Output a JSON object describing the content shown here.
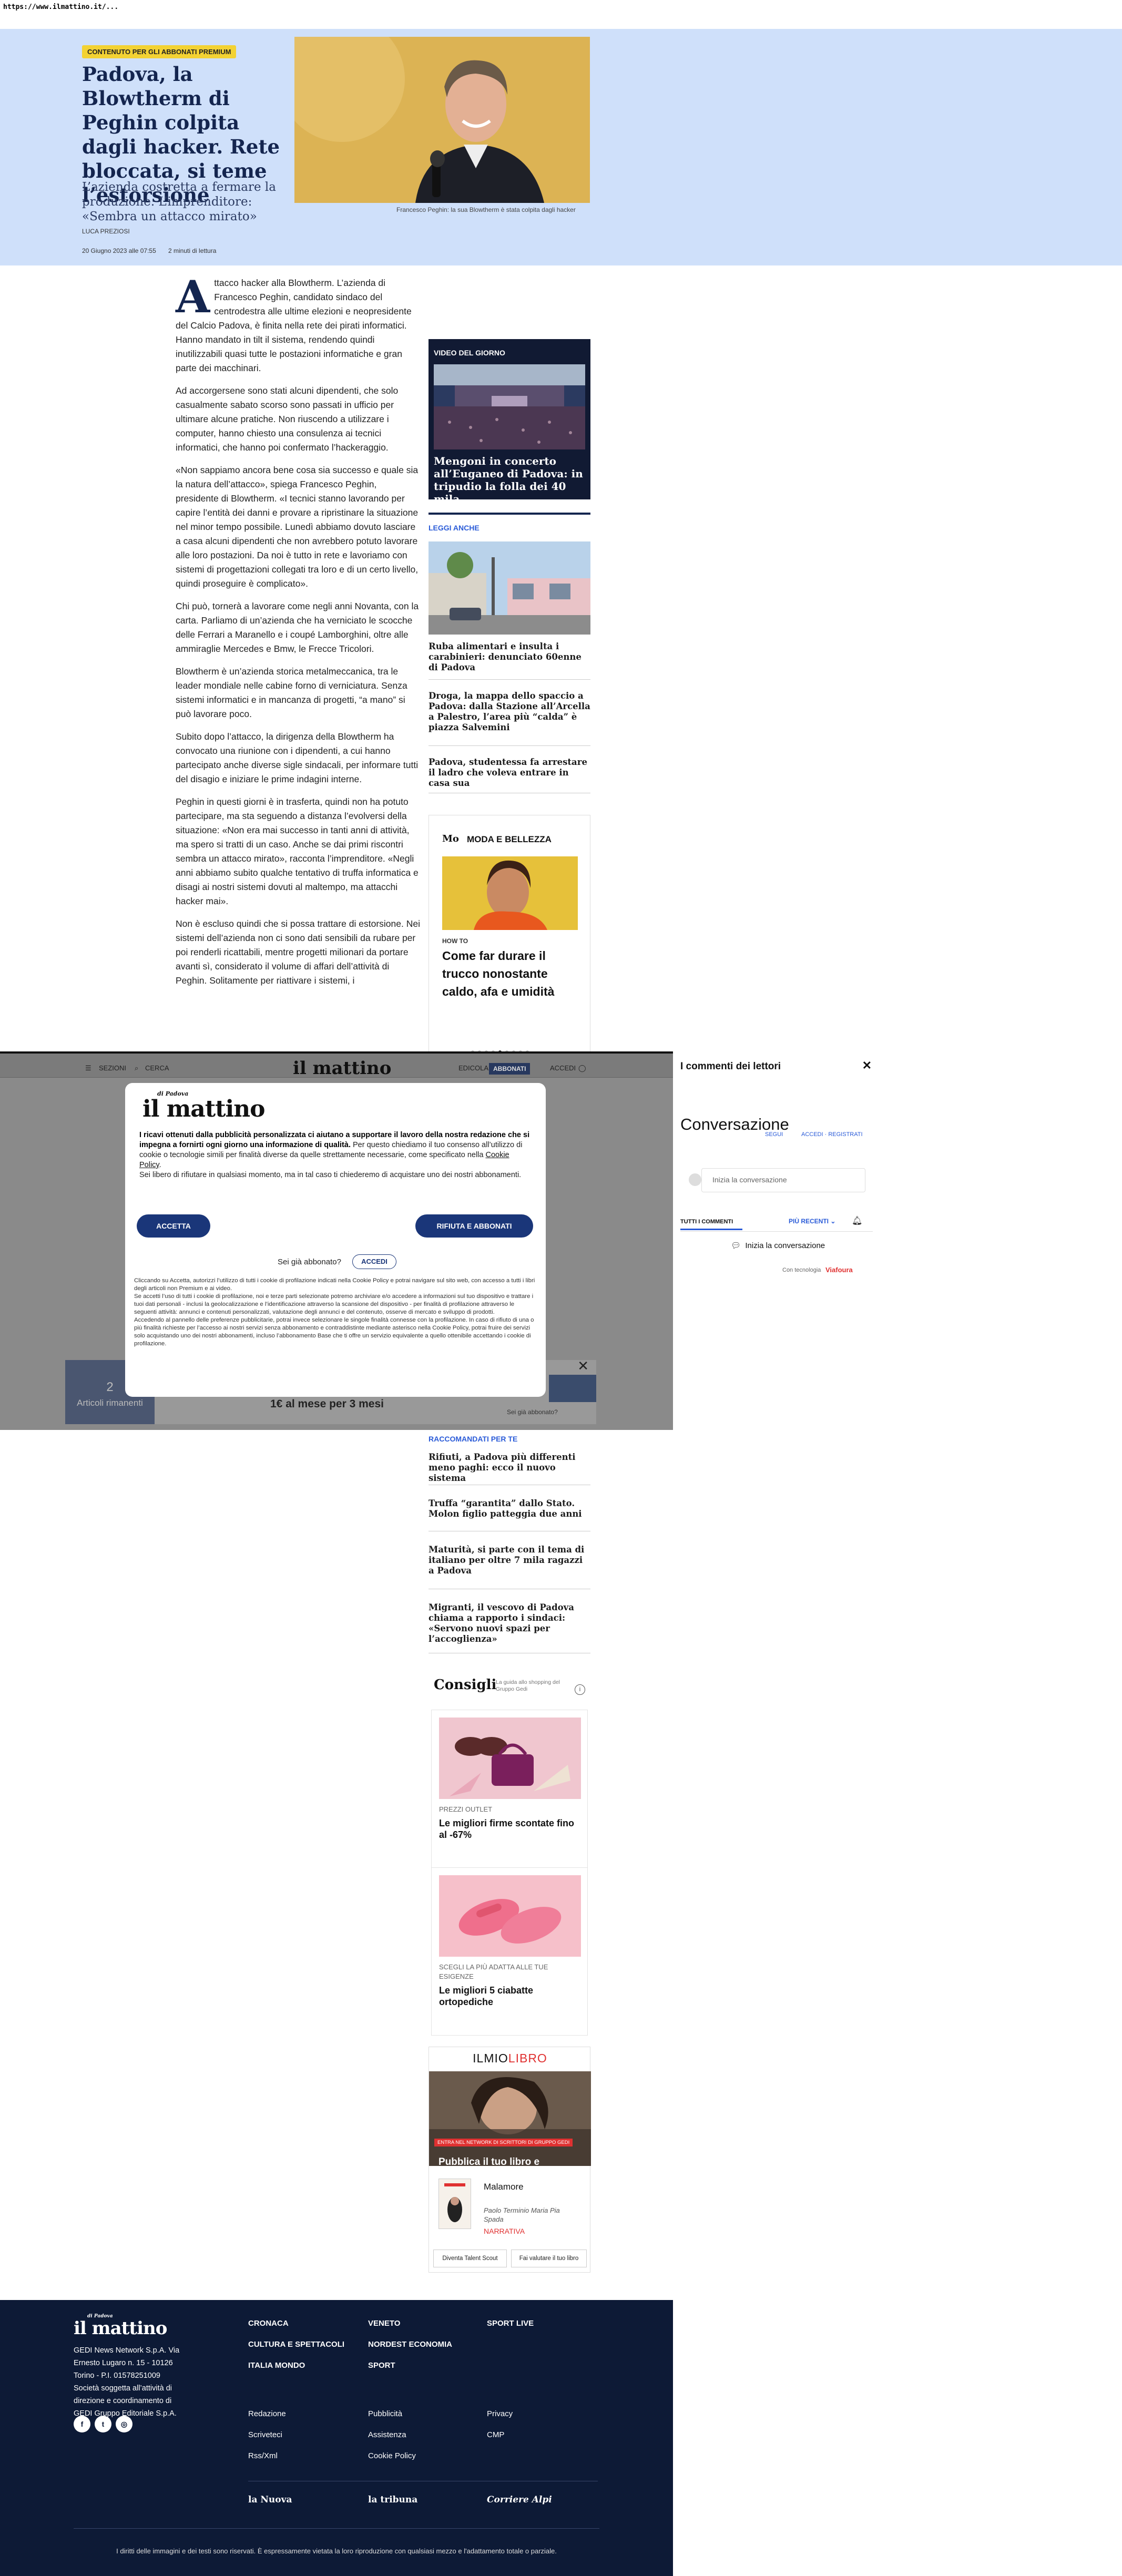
{
  "url": "https://www.ilmattino.it/...",
  "hero": {
    "badge": "CONTENUTO PER GLI ABBONATI PREMIUM",
    "title": "Padova, la Blowtherm di Peghin colpita dagli hacker. Rete bloccata, si teme l’estorsione",
    "subtitle": "L’azienda costretta a fermare la produzione. L’imprenditore: «Sembra un attacco mirato»",
    "author": "LUCA PREZIOSI",
    "date": "20 Giugno 2023 alle 07:55",
    "read_time": "2 minuti di lettura",
    "caption": "Francesco Peghin: la sua Blowtherm è stata colpita dagli hacker"
  },
  "article": {
    "dropcap": "A",
    "paragraphs": [
      "ttacco hacker alla Blowtherm. L’azienda di Francesco Peghin, candidato sindaco del centrodestra alle ultime elezioni e neopresidente del Calcio Padova, è finita nella rete dei pirati informatici. Hanno mandato in tilt il sistema, rendendo quindi inutilizzabili quasi tutte le postazioni informatiche e gran parte dei macchinari.",
      "Ad accorgersene sono stati alcuni dipendenti, che solo casualmente sabato scorso sono passati in ufficio per ultimare alcune pratiche. Non riuscendo a utilizzare i computer, hanno chiesto una consulenza ai tecnici informatici, che hanno poi confermato l’hackeraggio.",
      "«Non sappiamo ancora bene cosa sia successo e quale sia la natura dell’attacco», spiega Francesco Peghin, presidente di Blowtherm. «I tecnici stanno lavorando per capire l’entità dei danni e provare a ripristinare la situazione nel minor tempo possibile. Lunedì abbiamo dovuto lasciare a casa alcuni dipendenti che non avrebbero potuto lavorare alle loro postazioni. Da noi è tutto in rete e lavoriamo con sistemi di progettazioni collegati tra loro e di un certo livello, quindi proseguire è complicato».",
      "Chi può, tornerà a lavorare come negli anni Novanta, con la carta. Parliamo di un’azienda che ha verniciato le scocche delle Ferrari a Maranello e i coupé Lamborghini, oltre alle ammiraglie Mercedes e Bmw, le Frecce Tricolori.",
      "Blowtherm è un’azienda storica metalmeccanica, tra le leader mondiale nelle cabine forno di verniciatura. Senza sistemi informatici e in mancanza di progetti, “a mano” si può lavorare poco.",
      "Subito dopo l’attacco, la dirigenza della Blowtherm ha convocato una riunione con i dipendenti, a cui hanno partecipato anche diverse sigle sindacali, per informare tutti del disagio e iniziare le prime indagini interne.",
      "Peghin in questi giorni è in trasferta, quindi non ha potuto partecipare, ma sta seguendo a distanza l’evolversi della situazione: «Non era mai successo in tanti anni di attività, ma spero si tratti di un caso. Anche se dai primi riscontri sembra un attacco mirato», racconta l’imprenditore. «Negli anni abbiamo subito qualche tentativo di truffa informatica e disagi ai nostri sistemi dovuti al maltempo, ma attacchi hacker mai».",
      "Non è escluso quindi che si possa trattare di estorsione. Nei sistemi dell’azienda non ci sono dati sensibili da rubare per poi renderli ricattabili, mentre progetti milionari da portare avanti sì, considerato il volume di affari dell’attività di Peghin. Solitamente per riattivare i sistemi, i"
    ]
  },
  "video": {
    "label": "VIDEO DEL GIORNO",
    "title": "Mengoni in concerto all’Euganeo di Padova: in tripudio la folla dei 40 mila"
  },
  "leggi_anche": {
    "label": "LEGGI ANCHE",
    "items": [
      "Ruba alimentari e insulta i carabinieri: denunciato 60enne di Padova",
      "Droga, la mappa dello spaccio a Padova: dalla Stazione all’Arcella a Palestro, l’area più “calda” è piazza Salvemini",
      "Padova, studentessa fa arrestare il ladro che voleva entrare in casa sua"
    ]
  },
  "moda": {
    "logo": "Mo",
    "label": "MODA E BELLEZZA",
    "kicker": "HOW TO",
    "title": "Come far durare il trucco nonostante caldo, afa e umidità"
  },
  "nav": {
    "sezioni": "SEZIONI",
    "cerca": "CERCA",
    "logo": "il mattino",
    "edicola": "EDICOLA",
    "abbonati": "ABBONATI",
    "accedi": "ACCEDI"
  },
  "paywall": {
    "count": "2",
    "count_label": "Articoli rimanenti",
    "price": "1€ al mese per 3 mesi",
    "subscribed": "Sei già abbonato?"
  },
  "modal": {
    "logo": "il mattino",
    "logo_small": "di Padova",
    "text_bold": "I ricavi ottenuti dalla pubblicità personalizzata ci aiutano a supportare il lavoro della nostra redazione che si impegna a fornirti ogni giorno una informazione di qualità.",
    "text_rest": " Per questo chiediamo il tuo consenso all’utilizzo di cookie o tecnologie simili per finalità diverse da quelle strettamente necessarie, come specificato nella ",
    "text_link": "Cookie Policy",
    "text_after": "Sei libero di rifiutare in qualsiasi momento, ma in tal caso ti chiederemo di acquistare uno dei nostri abbonamenti.",
    "accept": "ACCETTA",
    "reject": "RIFIUTA E ABBONATI",
    "already": "Sei già abbonato?",
    "login": "ACCEDI",
    "fine_print": [
      "Cliccando su Accetta, autorizzi l’utilizzo di tutti i cookie di profilazione indicati nella Cookie Policy e potrai navigare sul sito web, con accesso a tutti i libri degli articoli non Premium e ai video.",
      "Se accetti l’uso di tutti i cookie di profilazione, noi e terze parti selezionate potremo archiviare e/o accedere a informazioni sul tuo dispositivo e trattare i tuoi dati personali - inclusi la geolocalizzazione e l’identificazione attraverso la scansione del dispositivo - per finalità di profilazione attraverso le seguenti attività: annunci e contenuti personalizzati, valutazione degli annunci e del contenuto, osserve di mercato e sviluppo di prodotti.",
      "Accedendo al pannello delle preferenze pubblicitarie, potrai invece selezionare le singole finalità connesse con la profilazione. In caso di rifiuto di una o più finalità richieste per l’accesso ai nostri servizi senza abbonamento e contraddistinte mediante asterisco nella Cookie Policy, potrai fruire dei servizi solo acquistando uno dei nostri abbonamenti, incluso l’abbonamento Base che ti offre un servizio equivalente a quello ottenibile accettando i cookie di profilazione."
    ]
  },
  "comments": {
    "header": "I commenti dei lettori",
    "title": "Conversazione",
    "login_a": "SEGUI",
    "login_b": "ACCEDI · REGISTRATI",
    "input_placeholder": "Inizia la conversazione",
    "tab_all": "TUTTI I COMMENTI",
    "sort": "PIÙ RECENTI",
    "start": "Inizia la conversazione",
    "tech": "Con tecnologia",
    "brand": "Viafoura"
  },
  "raccomandati": {
    "label": "RACCOMANDATI PER TE",
    "items": [
      "Rifiuti, a Padova più differenti meno paghi: ecco il nuovo sistema",
      "Truffa “garantita” dallo Stato. Molon figlio patteggia due anni",
      "Maturità, si parte con il tema di italiano per oltre 7 mila ragazzi a Padova",
      "Migranti, il vescovo di Padova chiama a rapporto i sindaci: «Servono nuovi spazi per l’accoglienza»"
    ]
  },
  "consigli": {
    "title": "Consigli",
    "guide": "La guida allo shopping del Gruppo Gedi",
    "cards": [
      {
        "kicker": "PREZZI OUTLET",
        "title": "Le migliori firme scontate fino al -67%"
      },
      {
        "kicker": "SCEGLI LA PIÙ ADATTA ALLE TUE ESIGENZE",
        "title": "Le migliori 5 ciabatte ortopediche"
      }
    ]
  },
  "miolibro": {
    "logo_a": "ILMIO",
    "logo_b": "LIBRO",
    "strip": "ENTRA NEL NETWORK DI SCRITTORI DI GRUPPO GEDI",
    "title": "Pubblica il tuo libro e fatti scoprire",
    "book_title": "Malamore",
    "book_author": "Paolo Terminio Maria Pia Spada",
    "book_genre": "NARRATIVA",
    "btn_talent": "Diventa Talent Scout",
    "btn_valutare": "Fai valutare il tuo libro"
  },
  "footer": {
    "logo": "il mattino",
    "logo_small": "di Padova",
    "address": "GEDI News Network S.p.A. Via Ernesto Lugaro n. 15 - 10126 Torino - P.I. 01578251009 Società soggetta all’attività di direzione e coordinamento di GEDI Gruppo Editoriale S.p.A.",
    "sections": [
      "CRONACA",
      "VENETO",
      "SPORT LIVE",
      "CULTURA E SPETTACOLI",
      "NORDEST ECONOMIA",
      "ITALIA MONDO",
      "SPORT"
    ],
    "links": [
      "Redazione",
      "Pubblicità",
      "Privacy",
      "Scrivetеci",
      "Assistenza",
      "CMP",
      "Rss/Xml",
      "Cookie Policy"
    ],
    "brands": [
      "la Nuova",
      "la tribuna",
      "Corriere Alpi"
    ],
    "copyright": "I diritti delle immagini e dei testi sono riservati. È espressamente vietata la loro riproduzione con qualsiasi mezzo e l'adattamento totale o parziale."
  }
}
